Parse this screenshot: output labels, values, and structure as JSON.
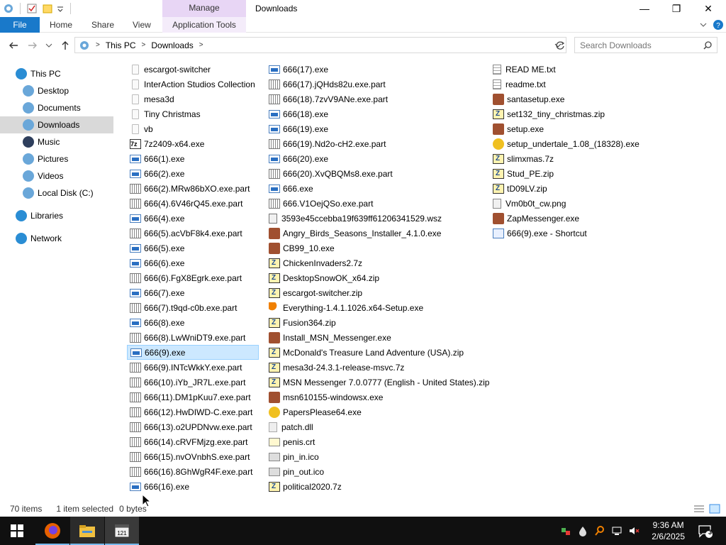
{
  "title_bar": {
    "manage_tab": "Manage",
    "window_title": "Downloads",
    "minimize_glyph": "—",
    "maximize_glyph": "❐",
    "close_glyph": "✕"
  },
  "ribbon": {
    "file": "File",
    "home": "Home",
    "share": "Share",
    "view": "View",
    "app_tools": "Application Tools"
  },
  "address_bar": {
    "crumbs": [
      "This PC",
      "Downloads"
    ],
    "search_placeholder": "Search Downloads"
  },
  "nav_pane": {
    "items": [
      {
        "label": "This PC",
        "icon": "this-pc-icon",
        "color": "#2a8dd4"
      },
      {
        "label": "Desktop",
        "icon": "desktop-icon",
        "color": "#6aa7d9"
      },
      {
        "label": "Documents",
        "icon": "documents-icon",
        "color": "#6aa7d9"
      },
      {
        "label": "Downloads",
        "icon": "downloads-icon",
        "color": "#6aa7d9"
      },
      {
        "label": "Music",
        "icon": "music-icon",
        "color": "#2e3e5c"
      },
      {
        "label": "Pictures",
        "icon": "pictures-icon",
        "color": "#6aa7d9"
      },
      {
        "label": "Videos",
        "icon": "videos-icon",
        "color": "#6aa7d9"
      },
      {
        "label": "Local Disk (C:)",
        "icon": "local-disk-icon",
        "color": "#6aa7d9"
      },
      {
        "label": "Libraries",
        "icon": "libraries-icon",
        "color": "#2a8dd4"
      },
      {
        "label": "Network",
        "icon": "network-icon",
        "color": "#2a8dd4"
      }
    ],
    "selected": "Downloads"
  },
  "files": {
    "col1": [
      {
        "name": "escargot-switcher",
        "type": "folder"
      },
      {
        "name": "InterAction Studios Collection",
        "type": "folder"
      },
      {
        "name": "mesa3d",
        "type": "folder"
      },
      {
        "name": "Tiny Christmas",
        "type": "folder"
      },
      {
        "name": "vb",
        "type": "folder"
      },
      {
        "name": "7z2409-x64.exe",
        "type": "sevenz"
      },
      {
        "name": "666(1).exe",
        "type": "exe"
      },
      {
        "name": "666(2).exe",
        "type": "exe"
      },
      {
        "name": "666(2).MRw86bXO.exe.part",
        "type": "part"
      },
      {
        "name": "666(4).6V46rQ45.exe.part",
        "type": "part"
      },
      {
        "name": "666(4).exe",
        "type": "exe"
      },
      {
        "name": "666(5).acVbF8k4.exe.part",
        "type": "part"
      },
      {
        "name": "666(5).exe",
        "type": "exe"
      },
      {
        "name": "666(6).exe",
        "type": "exe"
      },
      {
        "name": "666(6).FgX8Egrk.exe.part",
        "type": "part"
      },
      {
        "name": "666(7).exe",
        "type": "exe"
      },
      {
        "name": "666(7).t9qd-c0b.exe.part",
        "type": "part"
      },
      {
        "name": "666(8).exe",
        "type": "exe"
      },
      {
        "name": "666(8).LwWniDT9.exe.part",
        "type": "part"
      },
      {
        "name": "666(9).exe",
        "type": "exe",
        "selected": true
      },
      {
        "name": "666(9).INTcWkkY.exe.part",
        "type": "part"
      },
      {
        "name": "666(10).iYb_JR7L.exe.part",
        "type": "part"
      },
      {
        "name": "666(11).DM1pKuu7.exe.part",
        "type": "part"
      },
      {
        "name": "666(12).HwDIWD-C.exe.part",
        "type": "part"
      },
      {
        "name": "666(13).o2UPDNvw.exe.part",
        "type": "part"
      },
      {
        "name": "666(14).cRVFMjzg.exe.part",
        "type": "part"
      },
      {
        "name": "666(15).nvOVnbhS.exe.part",
        "type": "part"
      },
      {
        "name": "666(16).8GhWgR4F.exe.part",
        "type": "part"
      },
      {
        "name": "666(16).exe",
        "type": "exe"
      }
    ],
    "col2": [
      {
        "name": "666(17).exe",
        "type": "exe"
      },
      {
        "name": "666(17).jQHds82u.exe.part",
        "type": "part"
      },
      {
        "name": "666(18).7zvV9ANe.exe.part",
        "type": "part"
      },
      {
        "name": "666(18).exe",
        "type": "exe"
      },
      {
        "name": "666(19).exe",
        "type": "exe"
      },
      {
        "name": "666(19).Nd2o-cH2.exe.part",
        "type": "part"
      },
      {
        "name": "666(20).exe",
        "type": "exe"
      },
      {
        "name": "666(20).XvQBQMs8.exe.part",
        "type": "part"
      },
      {
        "name": "666.exe",
        "type": "exe"
      },
      {
        "name": "666.V1OejQSo.exe.part",
        "type": "part"
      },
      {
        "name": "3593e45ccebba19f639ff61206341529.wsz",
        "type": "wsz"
      },
      {
        "name": "Angry_Birds_Seasons_Installer_4.1.0.exe",
        "type": "app"
      },
      {
        "name": "CB99_10.exe",
        "type": "app"
      },
      {
        "name": "ChickenInvaders2.7z",
        "type": "zip"
      },
      {
        "name": "DesktopSnowOK_x64.zip",
        "type": "zip"
      },
      {
        "name": "escargot-switcher.zip",
        "type": "zip"
      },
      {
        "name": "Everything-1.4.1.1026.x64-Setup.exe",
        "type": "key"
      },
      {
        "name": "Fusion364.zip",
        "type": "zip"
      },
      {
        "name": "Install_MSN_Messenger.exe",
        "type": "app"
      },
      {
        "name": "McDonald's Treasure Land Adventure (USA).zip",
        "type": "zip"
      },
      {
        "name": "mesa3d-24.3.1-release-msvc.7z",
        "type": "zip"
      },
      {
        "name": "MSN Messenger 7.0.0777 (English - United States).zip",
        "type": "zip"
      },
      {
        "name": "msn610155-windowsx.exe",
        "type": "app"
      },
      {
        "name": "PapersPlease64.exe",
        "type": "game"
      },
      {
        "name": "patch.dll",
        "type": "dll"
      },
      {
        "name": "penis.crt",
        "type": "crt"
      },
      {
        "name": "pin_in.ico",
        "type": "ico"
      },
      {
        "name": "pin_out.ico",
        "type": "ico"
      },
      {
        "name": "political2020.7z",
        "type": "zip"
      }
    ],
    "col3": [
      {
        "name": "READ ME.txt",
        "type": "txt"
      },
      {
        "name": "readme.txt",
        "type": "txt"
      },
      {
        "name": "santasetup.exe",
        "type": "app"
      },
      {
        "name": "set132_tiny_christmas.zip",
        "type": "zip"
      },
      {
        "name": "setup.exe",
        "type": "app"
      },
      {
        "name": "setup_undertale_1.08_(18328).exe",
        "type": "game"
      },
      {
        "name": "slimxmas.7z",
        "type": "zip"
      },
      {
        "name": "Stud_PE.zip",
        "type": "zip"
      },
      {
        "name": "tD09LV.zip",
        "type": "zip"
      },
      {
        "name": "Vm0b0t_cw.png",
        "type": "png"
      },
      {
        "name": "ZapMessenger.exe",
        "type": "app"
      },
      {
        "name": "666(9).exe - Shortcut",
        "type": "shortcut"
      }
    ]
  },
  "status_bar": {
    "item_count": "70 items",
    "selection": "1 item selected",
    "size": "0 bytes"
  },
  "taskbar": {
    "time": "9:36 AM",
    "date": "2/6/2025",
    "notification_count": "3"
  },
  "colors": {
    "accent": "#1979ca",
    "selection_bg": "#cce8ff",
    "manage_tab": "#e8d6f5",
    "taskbar": "#101010"
  }
}
